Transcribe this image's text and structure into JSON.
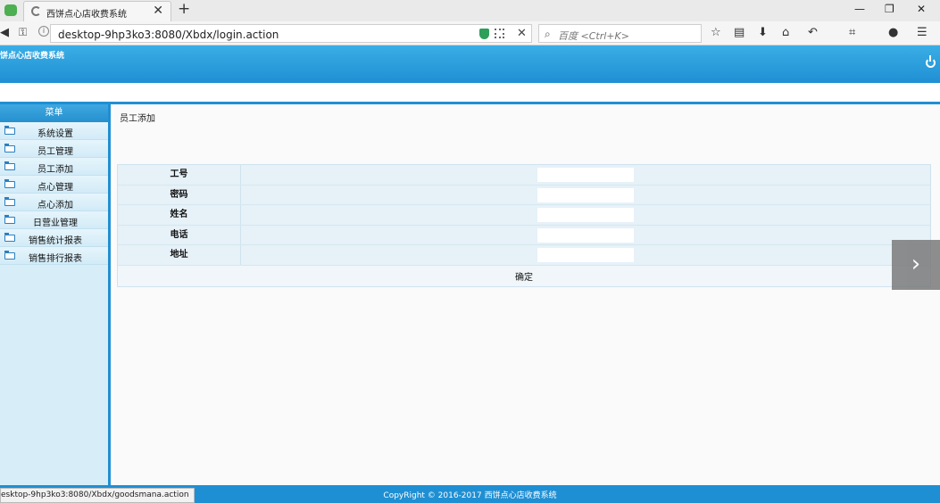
{
  "browser": {
    "tab_title": "西饼点心店收费系统",
    "new_tab": "+",
    "tab_close": "✕",
    "url": "desktop-9hp3ko3:8080/Xbdx/login.action",
    "search_placeholder": "百度 <Ctrl+K>",
    "status_url": "esktop-9hp3ko3:8080/Xbdx/goodsmana.action",
    "window_minimize": "—",
    "window_maximize": "❐",
    "window_close": "✕"
  },
  "app": {
    "title": "饼点心店收费系统"
  },
  "sidebar": {
    "header": "菜单",
    "items": [
      {
        "label": "系统设置"
      },
      {
        "label": "员工管理"
      },
      {
        "label": "员工添加"
      },
      {
        "label": "点心管理"
      },
      {
        "label": "点心添加"
      },
      {
        "label": "日营业管理"
      },
      {
        "label": "销售统计报表"
      },
      {
        "label": "销售排行报表"
      }
    ]
  },
  "main": {
    "breadcrumb": "员工添加",
    "fields": [
      {
        "label": "工号",
        "value": ""
      },
      {
        "label": "密码",
        "value": ""
      },
      {
        "label": "姓名",
        "value": ""
      },
      {
        "label": "电话",
        "value": ""
      },
      {
        "label": "地址",
        "value": ""
      }
    ],
    "submit_label": "确定"
  },
  "footer": {
    "copyright": "CopyRight © 2016-2017 西饼点心店收费系统"
  },
  "icons": {
    "next": "›"
  }
}
